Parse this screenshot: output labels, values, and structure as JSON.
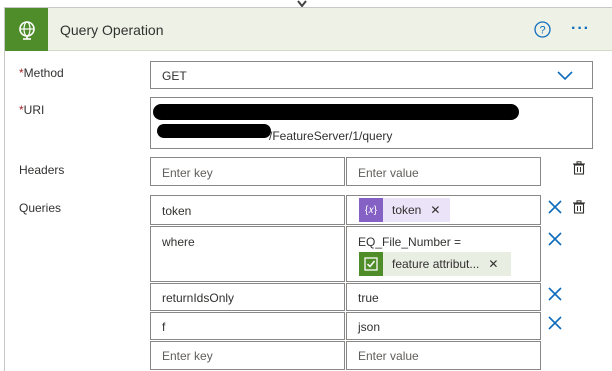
{
  "header": {
    "title": "Query Operation"
  },
  "method": {
    "label": "Method",
    "value": "GET"
  },
  "uri": {
    "label": "URI",
    "line2_visible": "/FeatureServer/1/query"
  },
  "headers": {
    "label": "Headers",
    "key_placeholder": "Enter key",
    "value_placeholder": "Enter value"
  },
  "queries": {
    "label": "Queries",
    "rows": [
      {
        "key": "token",
        "value_token": "token"
      },
      {
        "key": "where",
        "value_text": "EQ_File_Number =",
        "value_token": "feature attribut..."
      },
      {
        "key": "returnIdsOnly",
        "value": "true"
      },
      {
        "key": "f",
        "value": "json"
      }
    ],
    "key_placeholder": "Enter key",
    "value_placeholder": "Enter value"
  },
  "colors": {
    "accent": "#0f6cbd",
    "header_bg": "#eef2e6",
    "icon_green": "#4f8c2a",
    "token_purple": "#8661c5",
    "token_bg": "#ebe3f7",
    "token_bg2": "#e9eee3"
  }
}
